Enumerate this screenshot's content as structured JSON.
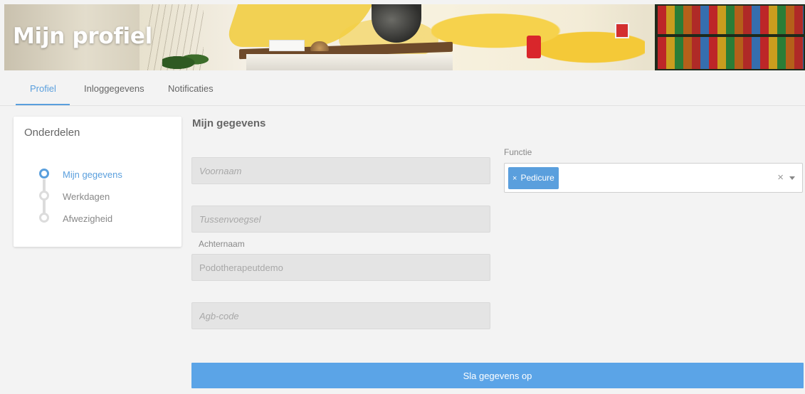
{
  "banner": {
    "title": "Mijn profiel"
  },
  "tabs": [
    {
      "label": "Profiel",
      "active": true
    },
    {
      "label": "Inloggegevens",
      "active": false
    },
    {
      "label": "Notificaties",
      "active": false
    }
  ],
  "sidebar": {
    "title": "Onderdelen",
    "items": [
      {
        "label": "Mijn gegevens",
        "active": true
      },
      {
        "label": "Werkdagen",
        "active": false
      },
      {
        "label": "Afwezigheid",
        "active": false
      }
    ]
  },
  "form": {
    "section_title": "Mijn gegevens",
    "voornaam": {
      "placeholder": "Voornaam",
      "value": ""
    },
    "tussenvoegsel": {
      "placeholder": "Tussenvoegsel",
      "value": ""
    },
    "achternaam": {
      "label": "Achternaam",
      "value": "Podotherapeutdemo"
    },
    "agb": {
      "placeholder": "Agb-code",
      "value": ""
    },
    "functie": {
      "label": "Functie",
      "selected": [
        "Pedicure"
      ],
      "remove_glyph": "×",
      "clear_glyph": "×"
    },
    "save_label": "Sla gegevens op"
  },
  "colors": {
    "accent": "#5a9fdd",
    "button": "#5ba4e7"
  }
}
